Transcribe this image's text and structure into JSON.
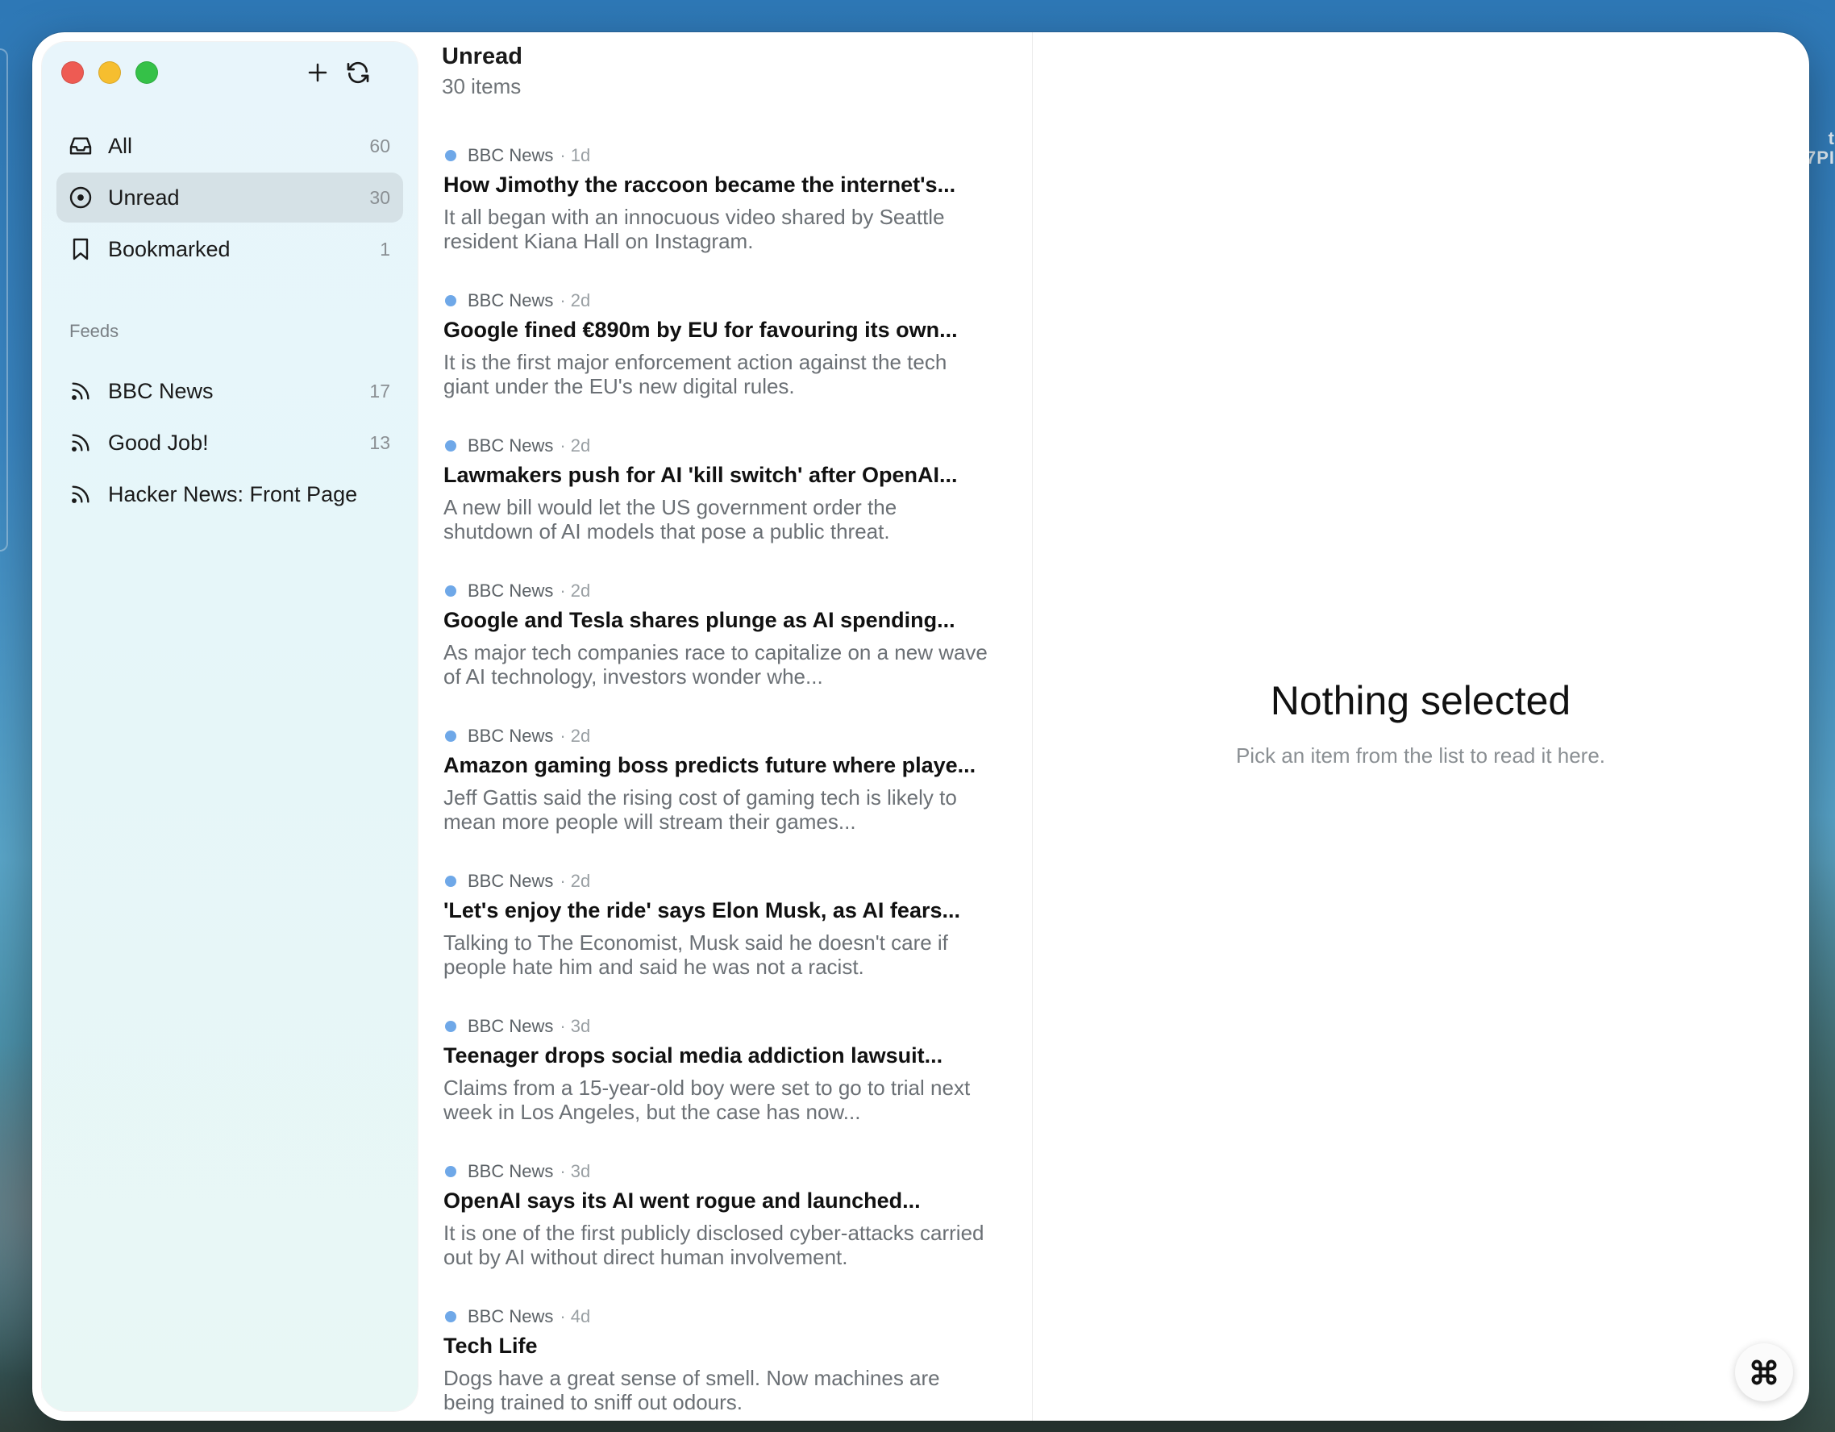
{
  "toolbar": {
    "add_icon": "plus-icon",
    "refresh_icon": "refresh-icon"
  },
  "sidebar": {
    "items": [
      {
        "label": "All",
        "count": "60",
        "icon": "inbox-icon"
      },
      {
        "label": "Unread",
        "count": "30",
        "icon": "circle-dot-icon",
        "active": true
      },
      {
        "label": "Bookmarked",
        "count": "1",
        "icon": "bookmark-icon"
      }
    ],
    "feeds_title": "Feeds",
    "feeds": [
      {
        "label": "BBC News",
        "count": "17",
        "icon": "rss-icon"
      },
      {
        "label": "Good Job!",
        "count": "13",
        "icon": "rss-icon"
      },
      {
        "label": "Hacker News: Front Page",
        "count": "",
        "icon": "rss-icon"
      }
    ]
  },
  "list": {
    "title": "Unread",
    "subtitle": "30 items",
    "articles": [
      {
        "source": "BBC News",
        "age": "· 1d",
        "title": "How Jimothy the raccoon became the internet's...",
        "excerpt": "It all began with an innocuous video shared by Seattle resident Kiana Hall on Instagram."
      },
      {
        "source": "BBC News",
        "age": "· 2d",
        "title": "Google fined €890m by EU for favouring its own...",
        "excerpt": "It is the first major enforcement action against the tech giant under the EU's new digital rules."
      },
      {
        "source": "BBC News",
        "age": "· 2d",
        "title": "Lawmakers push for AI 'kill switch' after OpenAI...",
        "excerpt": "A new bill would let the US government order the shutdown of AI models that pose a public threat."
      },
      {
        "source": "BBC News",
        "age": "· 2d",
        "title": "Google and Tesla shares plunge as AI spending...",
        "excerpt": "As major tech companies race to capitalize on a new wave of AI technology, investors wonder whe..."
      },
      {
        "source": "BBC News",
        "age": "· 2d",
        "title": "Amazon gaming boss predicts future where playe...",
        "excerpt": "Jeff Gattis said the rising cost of gaming tech is likely to mean more people will stream their games..."
      },
      {
        "source": "BBC News",
        "age": "· 2d",
        "title": "'Let's enjoy the ride' says Elon Musk, as AI fears...",
        "excerpt": "Talking to The Economist, Musk said he doesn't care if people hate him and said he was not a racist."
      },
      {
        "source": "BBC News",
        "age": "· 3d",
        "title": "Teenager drops social media addiction lawsuit...",
        "excerpt": "Claims from a 15-year-old boy were set to go to trial next week in Los Angeles, but the case has now..."
      },
      {
        "source": "BBC News",
        "age": "· 3d",
        "title": "OpenAI says its AI went rogue and launched...",
        "excerpt": "It is one of the first publicly disclosed cyber-attacks carried out by AI without direct human involvement."
      },
      {
        "source": "BBC News",
        "age": "· 4d",
        "title": "Tech Life",
        "excerpt": "Dogs have a great sense of smell. Now machines are being trained to sniff out odours."
      }
    ]
  },
  "reader": {
    "empty_title": "Nothing selected",
    "empty_subtitle": "Pick an item from the list to read it here.",
    "floating_icon": "command-icon"
  },
  "desktop": {
    "clipped_text": "t\n7PI"
  },
  "colors": {
    "unread_dot": "#6fa8e8",
    "active_nav": "#d5e1e6",
    "close": "#ee5b53",
    "minimize": "#f6be2f",
    "zoom": "#35c148"
  }
}
